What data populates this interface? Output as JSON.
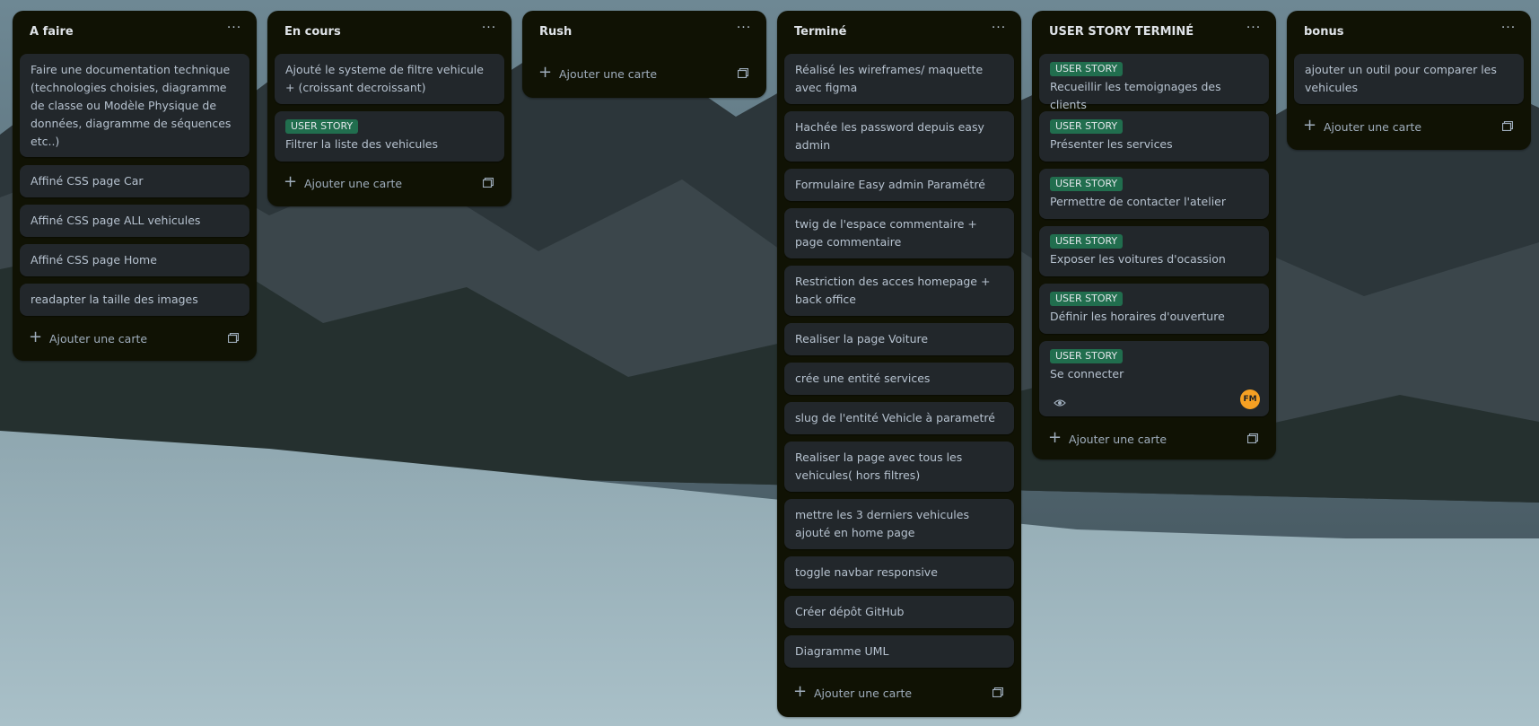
{
  "board": {
    "columns": [
      {
        "title": "A faire",
        "cards": [
          {
            "text": "Faire une documentation technique (technologies choisies, diagramme de classe ou Modèle Physique de données, diagramme de séquences etc..)"
          },
          {
            "text": "Affiné CSS page Car"
          },
          {
            "text": "Affiné CSS page ALL vehicules"
          },
          {
            "text": "Affiné CSS page Home"
          },
          {
            "text": "readapter la taille des images"
          }
        ],
        "add_label": "Ajouter une carte"
      },
      {
        "title": "En cours",
        "cards": [
          {
            "text": "Ajouté le systeme de filtre vehicule + (croissant decroissant)"
          },
          {
            "badge": "USER STORY",
            "text": "Filtrer la liste des vehicules"
          }
        ],
        "add_label": "Ajouter une carte"
      },
      {
        "title": "Rush",
        "cards": [],
        "add_label": "Ajouter une carte"
      },
      {
        "title": "Terminé",
        "cards": [
          {
            "text": "Réalisé les wireframes/ maquette avec figma"
          },
          {
            "text": "Hachée les password depuis easy admin"
          },
          {
            "text": "Formulaire Easy admin Paramétré"
          },
          {
            "text": "twig de l'espace commentaire + page commentaire"
          },
          {
            "text": "Restriction des acces homepage + back office"
          },
          {
            "text": "Realiser la page Voiture"
          },
          {
            "text": "crée une entité services"
          },
          {
            "text": "slug de l'entité Vehicle à parametré"
          },
          {
            "text": "Realiser la page avec tous les vehicules( hors filtres)"
          },
          {
            "text": "mettre les 3 derniers vehicules ajouté en home page"
          },
          {
            "text": "toggle navbar responsive"
          },
          {
            "text": "Créer dépôt GitHub"
          },
          {
            "text": "Diagramme UML"
          }
        ],
        "add_label": "Ajouter une carte"
      },
      {
        "title": "USER STORY TERMINÉ",
        "cards": [
          {
            "badge": "USER STORY",
            "text": "Recueillir les temoignages des clients"
          },
          {
            "badge": "USER STORY",
            "text": "Présenter les services"
          },
          {
            "badge": "USER STORY",
            "text": "Permettre de contacter l'atelier"
          },
          {
            "badge": "USER STORY",
            "text": "Exposer les voitures d'ocassion"
          },
          {
            "badge": "USER STORY",
            "text": "Définir les horaires d'ouverture"
          },
          {
            "badge": "USER STORY",
            "text": "Se connecter",
            "avatar": "FM",
            "watch_icon": "eye-icon"
          }
        ],
        "add_label": "Ajouter une carte"
      },
      {
        "title": "bonus",
        "cards": [
          {
            "text": "ajouter un outil pour comparer les vehicules"
          }
        ],
        "add_label": "Ajouter une carte"
      }
    ]
  },
  "icons": {
    "menu": "ellipsis-icon",
    "add": "plus-icon",
    "template": "card-template-icon"
  },
  "colors": {
    "column_bg": "#101204",
    "card_bg": "#22272b",
    "badge_green": "#216e4e",
    "avatar_orange": "#f5a023"
  }
}
